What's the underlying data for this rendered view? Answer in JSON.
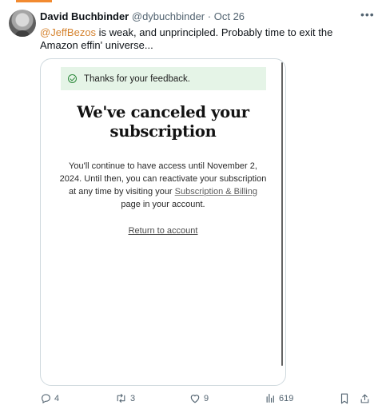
{
  "tweet": {
    "author_name": "David Buchbinder",
    "handle": "@dybuchbinder",
    "separator": "·",
    "date": "Oct 26",
    "mention": "@JeffBezos",
    "text": " is weak, and unprincipled. Probably time to exit the Amazon effin' universe..."
  },
  "media": {
    "feedback": "Thanks for your feedback.",
    "title_line1": "We've canceled your",
    "title_line2": "subscription",
    "access_text_before_link": "You'll continue to have access until November 2, 2024. Until then, you can reactivate your subscription at any time by visiting your ",
    "billing_link": "Subscription & Billing",
    "access_text_after_link": " page in your account.",
    "return_link": "Return to account"
  },
  "actions": {
    "replies": "4",
    "reposts": "3",
    "likes": "9",
    "views": "619"
  },
  "colors": {
    "mention": "#d5832f",
    "banner_bg": "#e5f4e7",
    "check": "#2e8a3d",
    "muted": "#536471"
  },
  "icons": [
    "more-icon",
    "check-circle-icon",
    "reply-icon",
    "repost-icon",
    "like-icon",
    "views-icon",
    "bookmark-icon",
    "share-icon"
  ]
}
